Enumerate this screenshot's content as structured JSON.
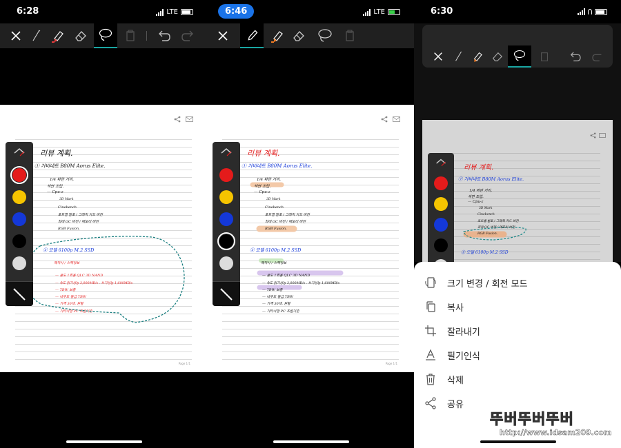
{
  "panels": [
    {
      "time": "6:28",
      "network": "LTE",
      "notes": {
        "heading": "리뷰 계획.",
        "item1": "① 가비네트 B80M Aorus Elite.",
        "lines1": [
          "1/4 파란 거리.",
          "색연 조립.",
          "— Cpu-z",
          "3D Mark",
          "Cinebench",
          "포트별 발포 / 그래픽 카드 버전",
          "최대 OC 버전 / 메모리 버전",
          "RGB Fusion."
        ],
        "item2": "② 모델 6100p M.2 SSD",
        "lines2": [
          "제작사 / 스펙정보",
          "— 용도 1회용 QLC 3D NAND",
          "— 속도 읽기성능 3,000MB/s . 쓰기성능 1,600MB/s",
          "— TBW 보증",
          "— 내구도 등급 TBW",
          "— 가격 30대. 원활",
          "— 기타사항 PC 조립기준"
        ]
      },
      "page_number": "Page 1/1"
    },
    {
      "time": "6:46",
      "network": "LTE",
      "notes": {
        "heading": "리뷰 계획.",
        "item1": "① 가비네트 B80M Aorus Elite.",
        "lines1": [
          "1/4 파란 거리.",
          "색연 조립.",
          "— Cpu-z",
          "3D Mark",
          "Cinebench",
          "포트별 발포 / 그래픽 카드 버전",
          "최대 OC 버전 / 메모리 버전",
          "RGB Fusion."
        ],
        "item2": "② 모델 6100p M.2 SSD",
        "lines2": [
          "제작사 / 스펙정보",
          "— 용도 1회용 QLC 3D NAND",
          "— 속도 읽기성능 3,000MB/s . 쓰기성능 1,600MB/s",
          "— TBW 보증",
          "— 내구도 등급 TBW",
          "— 가격 30대. 원활",
          "— 기타사항 PC 조립기준"
        ]
      },
      "page_number": "Page 1/1"
    },
    {
      "time": "6:30",
      "notes": {
        "heading": "리뷰 계획.",
        "item1": "① 가비네트 B80M Aorus Elite.",
        "lines1": [
          "1/4 파란 거리.",
          "색연 조립.",
          "— Cpu-z",
          "3D Mark",
          "Cinebench",
          "포트별 발포 / 그래픽 카드 버전",
          "최대 OC 버전 / 메모리 버전",
          "RGB Fusion."
        ],
        "item2": "② 모델 6100p M.2 SSD"
      }
    }
  ],
  "palette_colors": {
    "red": "#e41b1b",
    "yellow": "#f5c400",
    "blue": "#1438d8",
    "black": "#000000",
    "white": "#dcdcdc"
  },
  "accent": "#19a7a3",
  "context_menu": [
    {
      "label": "크기 변경 / 회전 모드",
      "icon": "resize-rotate-icon"
    },
    {
      "label": "복사",
      "icon": "copy-icon"
    },
    {
      "label": "잘라내기",
      "icon": "crop-icon"
    },
    {
      "label": "필기인식",
      "icon": "handwriting-recognition-icon"
    },
    {
      "label": "삭제",
      "icon": "trash-icon"
    },
    {
      "label": "공유",
      "icon": "share-icon"
    }
  ],
  "watermark": {
    "main": "뚜버뚜버뚜버",
    "url": "http://www.idsam209.com"
  }
}
